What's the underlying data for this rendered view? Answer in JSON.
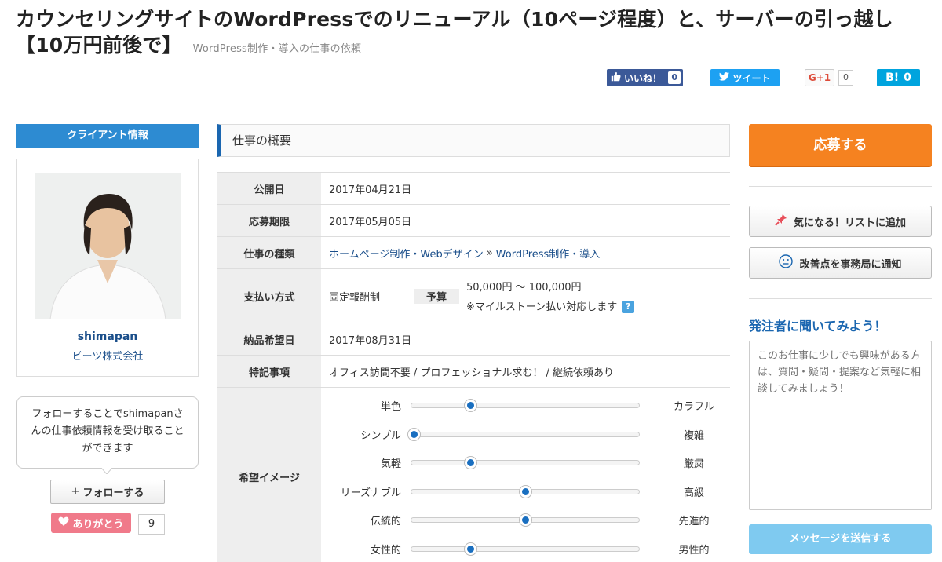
{
  "title": {
    "main": "カウンセリングサイトのWordPressでのリニューアル（10ページ程度）と、サーバーの引っ越し【10万円前後で】",
    "category": "WordPress制作・導入の仕事の依頼"
  },
  "social": {
    "like_label": "いいね！",
    "like_count": "0",
    "tweet_label": "ツイート",
    "gplus_label": "G+1",
    "gplus_count": "0",
    "hatena_label": "B!",
    "hatena_count": "0",
    "colors": {
      "facebook": "#3b5998",
      "twitter": "#1da1f2",
      "hatena": "#00a4de"
    }
  },
  "client": {
    "header": "クライアント情報",
    "username": "shimapan",
    "company": "ビーツ株式会社",
    "follow_text": "フォローすることでshimapanさんの仕事依頼情報を受け取ることができます",
    "follow_button": "フォローする",
    "thanks_label": "ありがとう",
    "thanks_count": "9"
  },
  "summary": {
    "header": "仕事の概要",
    "published_label": "公開日",
    "published": "2017年04月21日",
    "deadline_label": "応募期限",
    "deadline": "2017年05月05日",
    "type_label": "仕事の種類",
    "type_cat": "ホームページ制作・Webデザイン",
    "type_sep": "»",
    "type_sub": "WordPress制作・導入",
    "payment_label": "支払い方式",
    "payment_method": "固定報酬制",
    "budget_label": "予算",
    "budget": "50,000円 〜 100,000円",
    "milestone": "※マイルストーン払い対応します",
    "delivery_label": "納品希望日",
    "delivery": "2017年08月31日",
    "notes_label": "特記事項",
    "notes": "オフィス訪問不要 / プロフェッショナル求む！ / 継続依頼あり",
    "image_label": "希望イメージ",
    "sliders": [
      {
        "left": "単色",
        "right": "カラフル",
        "level": 0.26
      },
      {
        "left": "シンプル",
        "right": "複雑",
        "level": 0.01
      },
      {
        "left": "気軽",
        "right": "厳粛",
        "level": 0.26
      },
      {
        "left": "リーズナブル",
        "right": "高級",
        "level": 0.5
      },
      {
        "left": "伝統的",
        "right": "先進的",
        "level": 0.5
      },
      {
        "left": "女性的",
        "right": "男性的",
        "level": 0.26
      }
    ]
  },
  "actions": {
    "apply": "応募する",
    "bookmark": "気になる！リストに追加",
    "report": "改善点を事務局に通知",
    "ask_title": "発注者に聞いてみよう！",
    "ask_placeholder": "このお仕事に少しでも興味がある方は、質問・疑問・提案など気軽に相談してみましょう！",
    "send": "メッセージを送信する",
    "colors": {
      "apply": "#f58220",
      "send": "#7fcaf0",
      "accent": "#2d8bd2"
    }
  }
}
